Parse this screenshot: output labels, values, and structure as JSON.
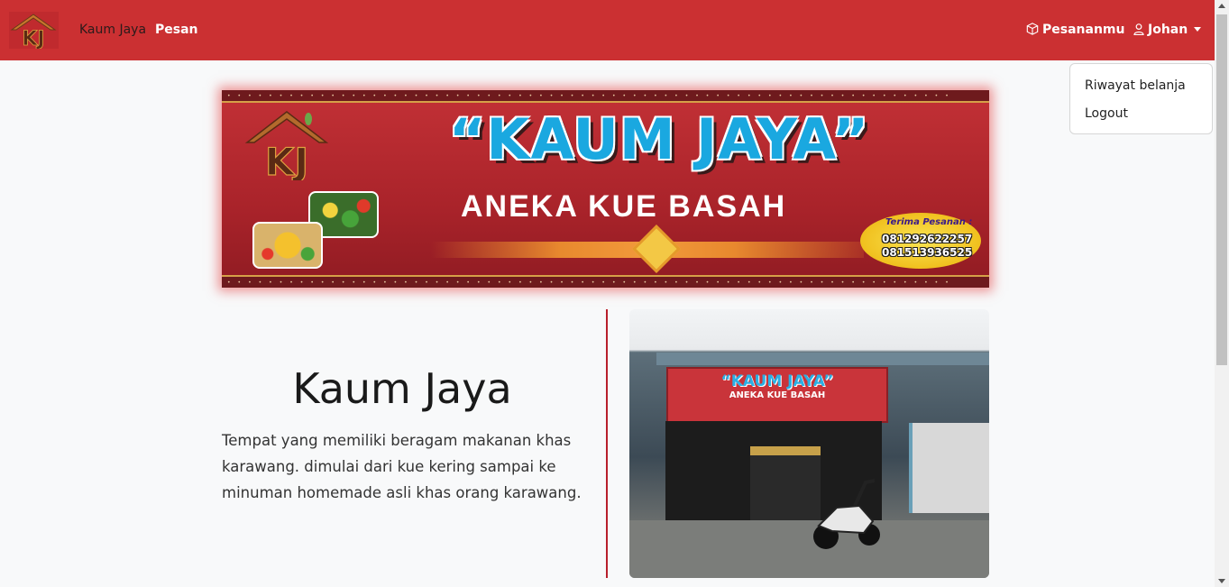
{
  "navbar": {
    "brand_logo_text": "KJ",
    "home_label": "Kaum Jaya",
    "order_label": "Pesan",
    "orders_label": "Pesananmu",
    "user_label": "Johan"
  },
  "dropdown": {
    "items": [
      "Riwayat belanja",
      "Logout"
    ]
  },
  "banner": {
    "logo_text": "KJ",
    "title": "“KAUM JAYA”",
    "subtitle": "ANEKA KUE BASAH",
    "contact_label": "Terima Pesanan :",
    "phones": [
      "081292622257",
      "081513936525"
    ]
  },
  "store": {
    "title": "Kaum Jaya",
    "description": "Tempat yang memiliki beragam makanan khas karawang. dimulai dari kue kering sampai ke minuman homemade asli khas orang karawang."
  },
  "photo": {
    "sign_title": "“KAUM JAYA”",
    "sign_subtitle": "ANEKA KUE BASAH"
  },
  "colors": {
    "navbar": "#cb3032",
    "accent_divider": "#b81f2b",
    "page_bg": "#f8f9fa"
  }
}
